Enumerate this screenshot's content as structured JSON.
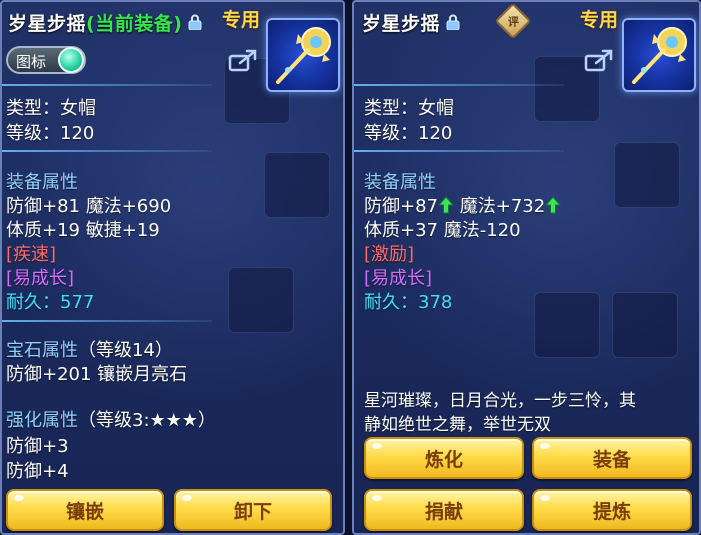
{
  "left": {
    "title": "岁星步摇",
    "equipped_tag": "(当前装备)",
    "special_tag": "专用",
    "toggle_label": "图标",
    "type_line": "类型：女帽",
    "level_line": "等级：120",
    "equip_attr_header": "装备属性",
    "attr_line1": "防御+81 魔法+690",
    "attr_line2": "体质+19 敏捷+19",
    "special_effect": "[疾速]",
    "growth": "[易成长]",
    "durability_label": "耐久：",
    "durability_value": "577",
    "gem_header": "宝石属性",
    "gem_level": "（等级14）",
    "gem_line": "防御+201 镶嵌月亮石",
    "enhance_header": "强化属性",
    "enhance_level": "（等级3:★★★）",
    "enhance_line1": "防御+3",
    "enhance_line2": "防御+4",
    "buttons": [
      "镶嵌",
      "卸下"
    ]
  },
  "right": {
    "title": "岁星步摇",
    "eval_badge": "评",
    "special_tag": "专用",
    "type_line": "类型：女帽",
    "level_line": "等级：120",
    "equip_attr_header": "装备属性",
    "attr_defense": "防御+87",
    "attr_magic": "魔法+732",
    "attr_line2": "体质+37 魔法-120",
    "special_effect": "[激励]",
    "growth": "[易成长]",
    "durability_label": "耐久：",
    "durability_value": "378",
    "description_line1": "星河璀璨，日月合光，一步三怜，其",
    "description_line2": "静如绝世之舞，举世无双",
    "buttons": [
      "炼化",
      "装备",
      "捐献",
      "提炼"
    ]
  },
  "colors": {
    "equipped": "#35e64e",
    "special": "#ffd94a",
    "section": "#8fd0ff",
    "effect": "#ff6b6b",
    "growth": "#d56cff",
    "durability": "#3fe0ff",
    "button": "#ffdc4a"
  },
  "icons": [
    "lock-icon",
    "share-icon",
    "hairpin-item-icon",
    "up-arrow-icon",
    "eval-badge"
  ]
}
